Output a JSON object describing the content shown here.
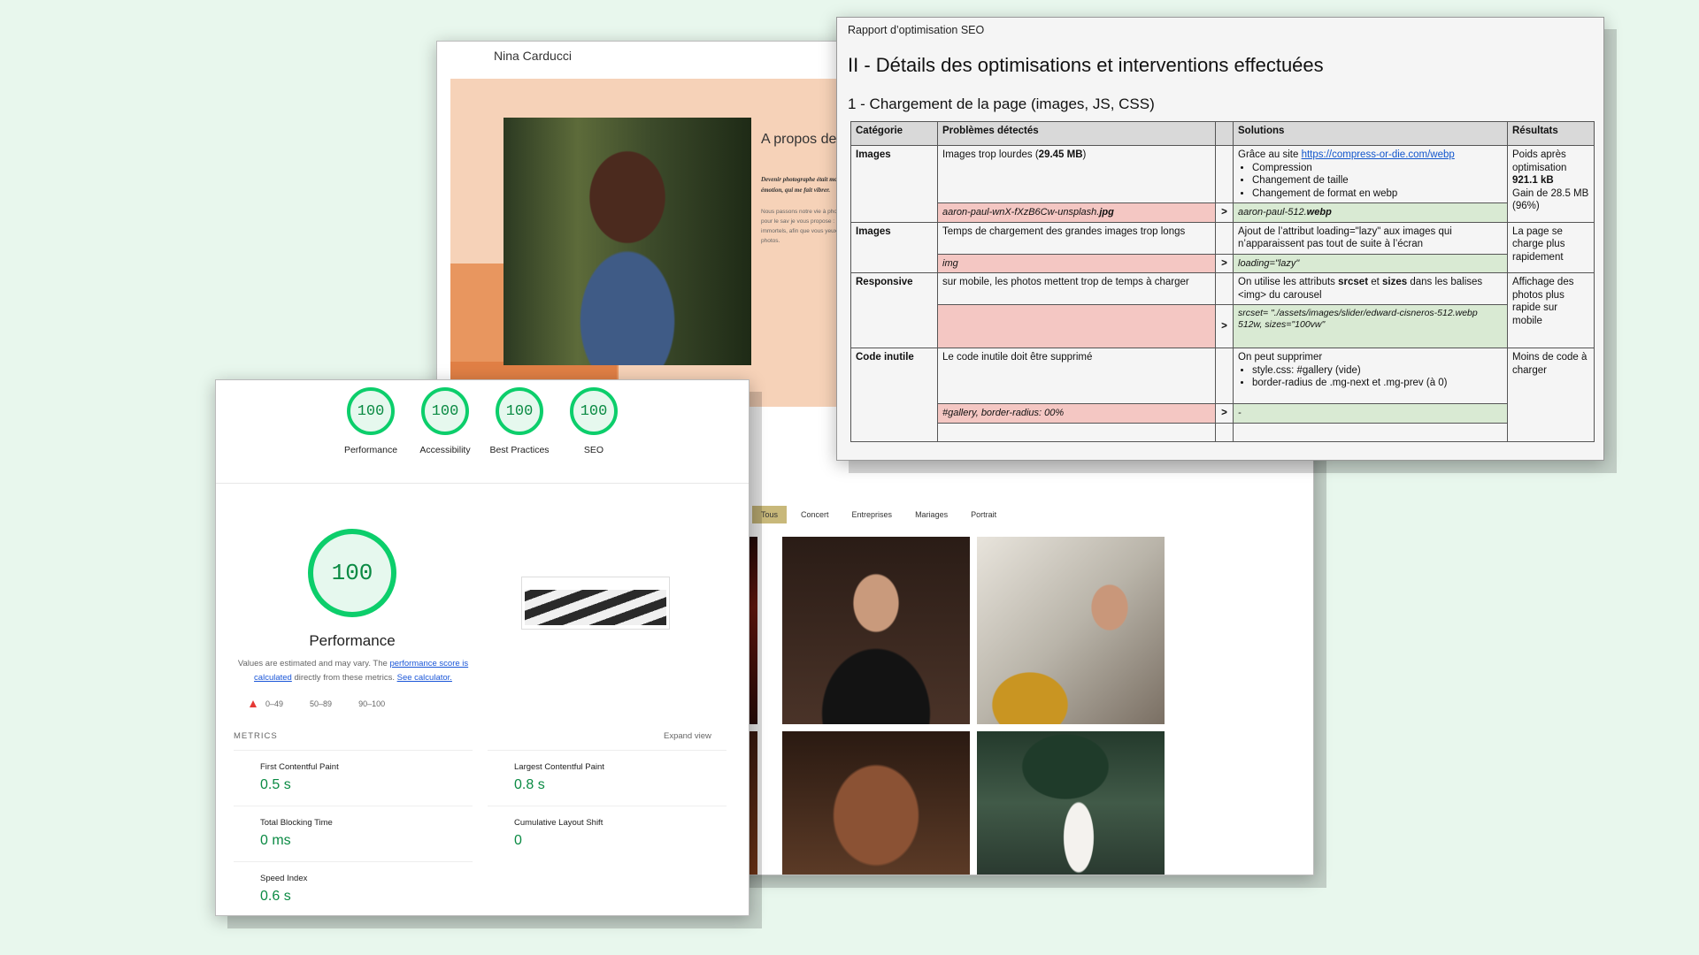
{
  "portfolio": {
    "brand": "Nina Carducci",
    "about_title": "A propos de",
    "about_quote": "Devenir photographe était moment, une émotion, qui me fait vibrer.",
    "about_text": "Nous passons notre vie à photographies pour le sav je vous propose : saisir ce immortels, afin que vous yeux sur vos photos.",
    "filters": [
      "Tous",
      "Concert",
      "Entreprises",
      "Mariages",
      "Portrait"
    ]
  },
  "lighthouse": {
    "gauges": [
      {
        "score": "100",
        "label": "Performance"
      },
      {
        "score": "100",
        "label": "Accessibility"
      },
      {
        "score": "100",
        "label": "Best Practices"
      },
      {
        "score": "100",
        "label": "SEO"
      }
    ],
    "main_score": "100",
    "main_label": "Performance",
    "note_prefix": "Values are estimated and may vary. The ",
    "note_link1": "performance score is calculated",
    "note_middle": " directly from these metrics. ",
    "note_link2": "See calculator.",
    "legend": [
      "0–49",
      "50–89",
      "90–100"
    ],
    "metrics_title": "METRICS",
    "expand": "Expand view",
    "metrics": [
      {
        "label": "First Contentful Paint",
        "value": "0.5 s"
      },
      {
        "label": "Largest Contentful Paint",
        "value": "0.8 s"
      },
      {
        "label": "Total Blocking Time",
        "value": "0 ms"
      },
      {
        "label": "Cumulative Layout Shift",
        "value": "0"
      },
      {
        "label": "Speed Index",
        "value": "0.6 s"
      }
    ],
    "colors": {
      "pass": "#0cce6b",
      "fail": "#e53935"
    }
  },
  "seo": {
    "doc_title": "Rapport d’optimisation SEO",
    "h2": "II - Détails des optimisations et interventions effectuées",
    "h3": "1 - Chargement de la page (images, JS, CSS)",
    "headers": {
      "cat": "Catégorie",
      "prob": "Problèmes détectés",
      "sol": "Solutions",
      "res": "Résultats"
    },
    "arrow": ">",
    "rows": [
      {
        "cat": "Images",
        "prob_a": "Images trop lourdes (",
        "prob_b": "29.45 MB",
        "prob_c": ")",
        "sol_a": "Grâce au site ",
        "sol_link": "https://compress-or-die.com/webp",
        "sol_list": [
          "Compression",
          "Changement de taille",
          "Changement de format en webp"
        ],
        "res_a": "Poids après optimisation",
        "res_b": "921.1 kB",
        "res_c": "Gain de 28.5 MB (96%)",
        "code_bad_a": "aaron-paul-wnX-fXzB6Cw-unsplash.",
        "code_bad_b": "jpg",
        "code_good_a": "aaron-paul-512.",
        "code_good_b": "webp"
      },
      {
        "cat": "Images",
        "prob": "Temps de chargement des grandes images trop longs",
        "sol": "Ajout de l’attribut loading=\"lazy\" aux images qui n’apparaissent pas tout de suite à l’écran",
        "res": "La page se charge plus rapidement",
        "code_bad": "img",
        "code_good": "loading=\"lazy\""
      },
      {
        "cat": "Responsive",
        "prob": "sur mobile, les photos mettent trop de temps à charger",
        "sol_a": "On utilise les attributs ",
        "sol_b": "srcset",
        "sol_c": " et ",
        "sol_d": "sizes",
        "sol_e": " dans les balises <img> du carousel",
        "res": "Affichage des photos plus rapide sur mobile",
        "code_good": "srcset= \"./assets/images/slider/edward-cisneros-512.webp   512w, sizes=\"100vw\""
      },
      {
        "cat": "Code inutile",
        "prob": "Le code inutile doit être supprimé",
        "sol": "On peut supprimer",
        "sol_list": [
          "style.css: #gallery (vide)",
          "border-radius de .mg-next et .mg-prev (à 0)"
        ],
        "res": "Moins de code à charger",
        "code_bad": "#gallery, border-radius: 00%",
        "code_good": "-"
      }
    ]
  }
}
